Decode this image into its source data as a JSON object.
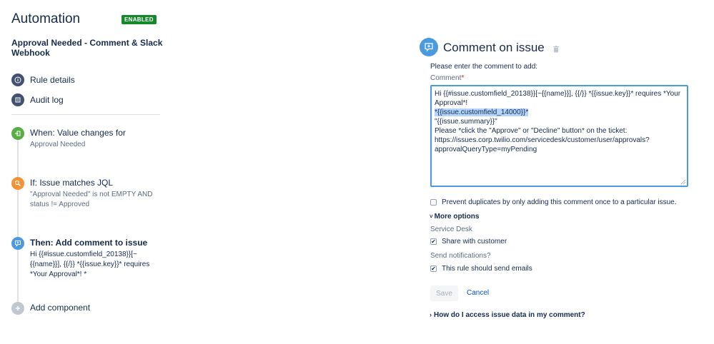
{
  "header": {
    "title": "Automation",
    "status_badge": "ENABLED"
  },
  "rule": {
    "name": "Approval Needed - Comment & Slack Webhook"
  },
  "nav": {
    "items": [
      {
        "label": "Rule details",
        "icon": "info-icon"
      },
      {
        "label": "Audit log",
        "icon": "list-icon"
      }
    ]
  },
  "steps": [
    {
      "title": "When: Value changes for",
      "desc": "Approval Needed",
      "icon": "trigger-icon",
      "color": "#5aac44"
    },
    {
      "title": "If: Issue matches JQL",
      "desc": "\"Approval Needed\" is not EMPTY AND status != Approved",
      "icon": "search-icon",
      "color": "#f79232"
    },
    {
      "title": "Then: Add comment to issue",
      "desc": "Hi {{#issue.customfield_20138}}[~{{name}}], {{/}} *{{issue.key}}* requires *Your Approval*! *",
      "icon": "comment-icon",
      "color": "#4a9ae1"
    },
    {
      "title": "Add component",
      "desc": "",
      "icon": "add-icon",
      "color": "#c1c7d0"
    }
  ],
  "action": {
    "title": "Comment on issue",
    "prompt": "Please enter the comment to add:",
    "comment_label": "Comment",
    "required_marker": "*",
    "comment_line_1": "Hi {{#issue.customfield_20138}}[~{{name}}], {{/}} *{{issue.key}}* requires *Your Approval*!\n",
    "comment_highlight": "*{{issue.customfield_14000}}*",
    "comment_rest": "\n\"{{issue.summary}}\"\nPlease *click the \"Approve\" or \"Decline\" button* on the ticket:\nhttps://issues.corp.twilio.com/servicedesk/customer/user/approvals?approvalQueryType=myPending",
    "prevent_duplicates_label": "Prevent duplicates by only adding this comment once to a particular issue.",
    "prevent_duplicates_checked": false,
    "more_options_label": "More options",
    "service_desk_label": "Service Desk",
    "share_label": "Share with customer",
    "share_checked": true,
    "notifications_label": "Send notifications?",
    "send_emails_label": "This rule should send emails",
    "send_emails_checked": true,
    "save_label": "Save",
    "cancel_label": "Cancel",
    "help_label": "How do I access issue data in my comment?"
  },
  "colors": {
    "accent": "#4a9ae1",
    "enabled": "#14892c",
    "link": "#0052cc"
  }
}
